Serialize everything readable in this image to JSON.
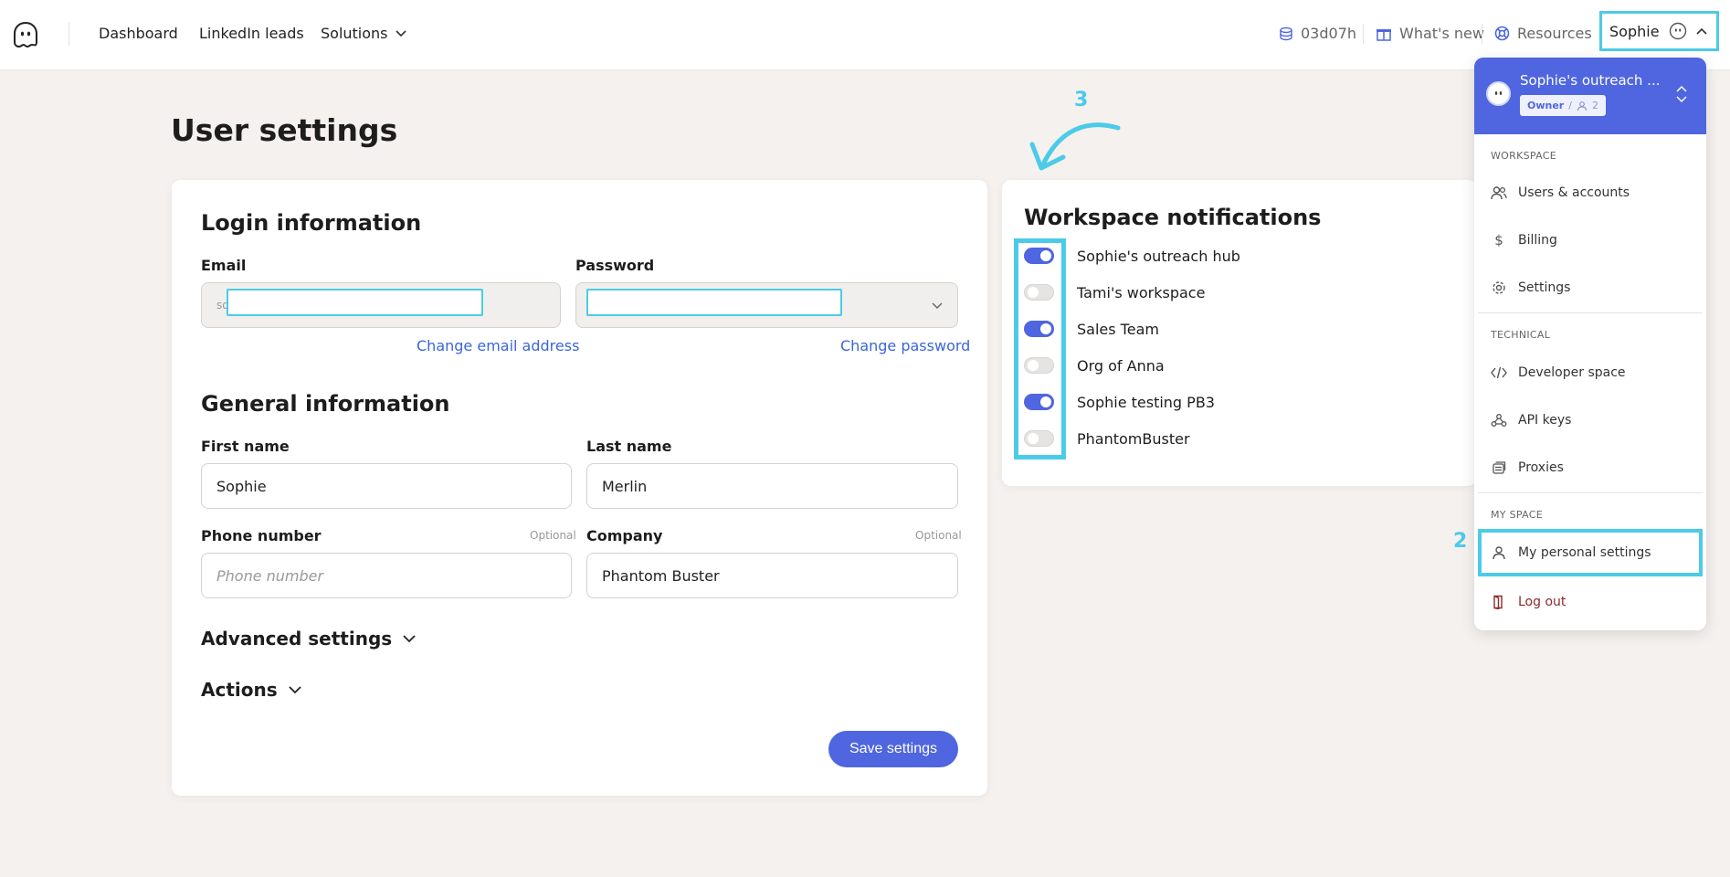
{
  "topbar": {
    "nav": [
      "Dashboard",
      "LinkedIn leads",
      "Solutions"
    ],
    "time_remaining": "03d07h",
    "whats_new": "What's new",
    "resources": "Resources",
    "user_name": "Sophie"
  },
  "page": {
    "title": "User settings"
  },
  "login": {
    "title": "Login information",
    "email_label": "Email",
    "email_value_partial": "so",
    "password_label": "Password",
    "change_email": "Change email address",
    "change_password": "Change password"
  },
  "general": {
    "title": "General information",
    "first_name_label": "First name",
    "first_name_value": "Sophie",
    "last_name_label": "Last name",
    "last_name_value": "Merlin",
    "phone_label": "Phone number",
    "phone_optional": "Optional",
    "phone_placeholder": "Phone number",
    "company_label": "Company",
    "company_optional": "Optional",
    "company_value": "Phantom Buster"
  },
  "sections": {
    "advanced": "Advanced settings",
    "actions": "Actions",
    "save": "Save settings"
  },
  "notifications": {
    "title": "Workspace notifications",
    "items": [
      {
        "label": "Sophie's outreach hub",
        "on": true
      },
      {
        "label": "Tami's workspace",
        "on": false
      },
      {
        "label": "Sales Team",
        "on": true
      },
      {
        "label": "Org of Anna",
        "on": false
      },
      {
        "label": "Sophie testing PB3",
        "on": true
      },
      {
        "label": "PhantomBuster",
        "on": false
      }
    ]
  },
  "annotations": {
    "step2": "2",
    "step3": "3"
  },
  "dropdown": {
    "workspace_name": "Sophie's outreach ...",
    "role": "Owner",
    "role_sep": "/",
    "member_count": "2",
    "section_workspace": "WORKSPACE",
    "users_accounts": "Users & accounts",
    "billing": "Billing",
    "settings": "Settings",
    "section_technical": "TECHNICAL",
    "developer_space": "Developer space",
    "api_keys": "API keys",
    "proxies": "Proxies",
    "section_my_space": "MY SPACE",
    "personal_settings": "My personal settings",
    "logout": "Log out"
  },
  "colors": {
    "accent": "#4f66e0",
    "annotation": "#4ccbe8",
    "background": "#f4f1ee",
    "link": "#3b66d6"
  }
}
